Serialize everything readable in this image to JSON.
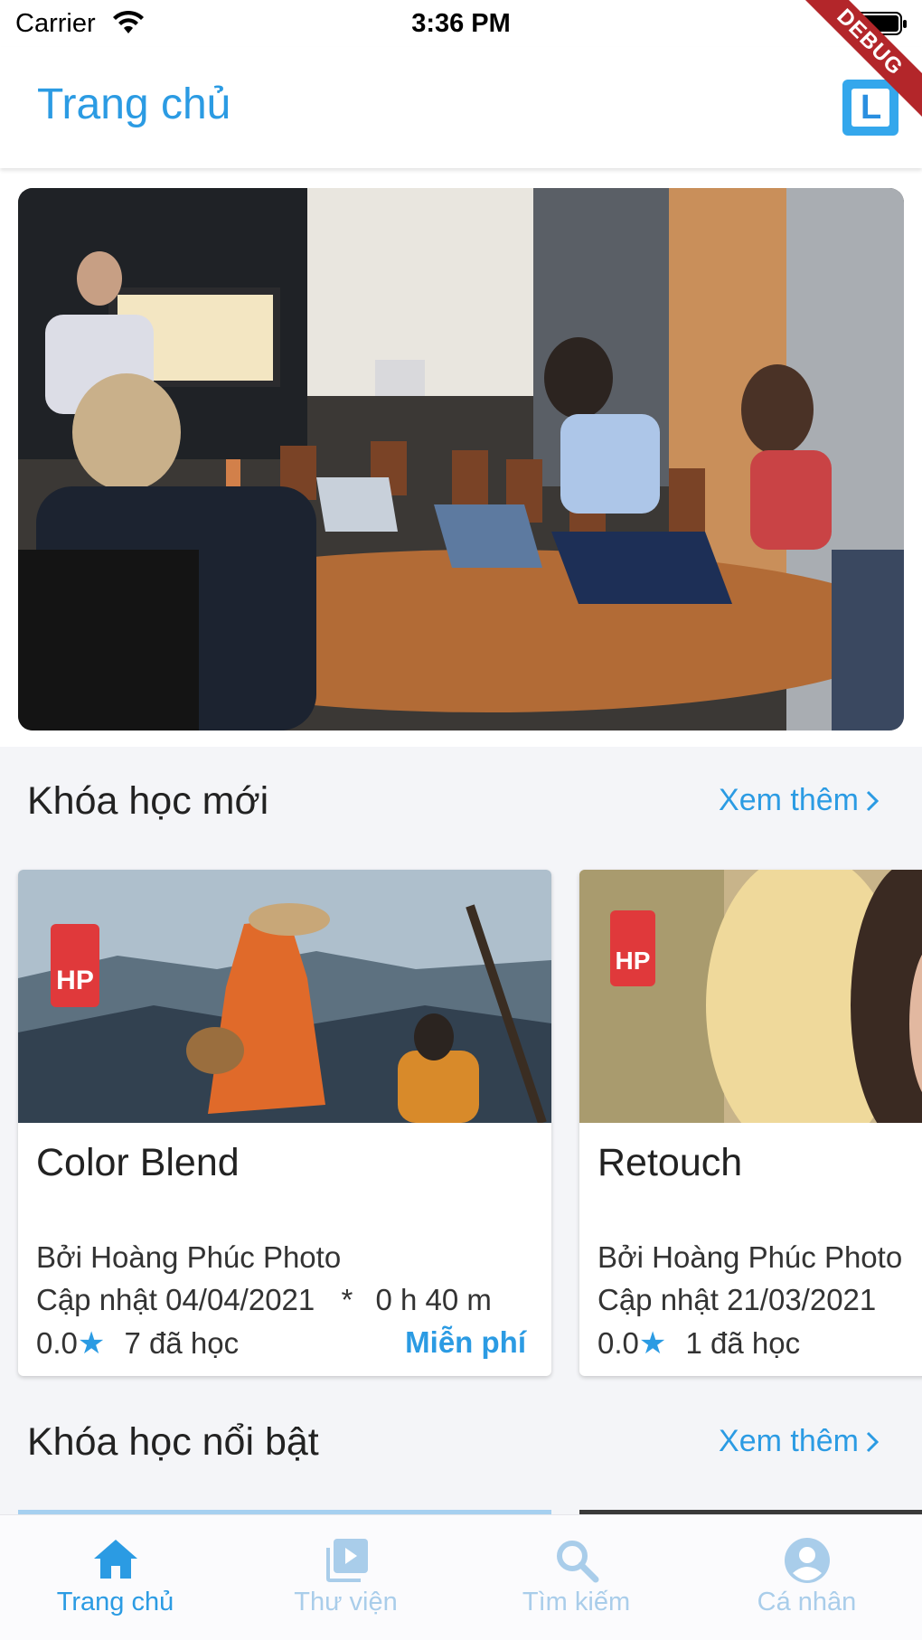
{
  "status_bar": {
    "carrier": "Carrier",
    "time": "3:36 PM"
  },
  "debug_label": "DEBUG",
  "app_bar": {
    "title": "Trang chủ",
    "logo_letter": "L"
  },
  "sections": {
    "new_courses": {
      "title": "Khóa học mới",
      "see_more": "Xem thêm"
    },
    "featured_courses": {
      "title": "Khóa học nổi bật",
      "see_more": "Xem thêm"
    }
  },
  "courses": [
    {
      "badge": "HP",
      "title": "Color Blend",
      "author": "Bởi Hoàng Phúc Photo",
      "updated": "Cập nhật 04/04/2021",
      "separator": "*",
      "duration": "0 h 40 m",
      "rating": "0.0",
      "learners": "7 đã học",
      "price": "Miễn phí"
    },
    {
      "badge": "HP",
      "title": "Retouch",
      "author": "Bởi Hoàng Phúc Photo",
      "updated": "Cập nhật 21/03/2021",
      "rating": "0.0",
      "learners": "1 đã học"
    }
  ],
  "bottom_nav": [
    {
      "label": "Trang chủ",
      "icon": "home-icon",
      "active": true
    },
    {
      "label": "Thư viện",
      "icon": "video-library-icon",
      "active": false
    },
    {
      "label": "Tìm kiếm",
      "icon": "search-icon",
      "active": false
    },
    {
      "label": "Cá nhân",
      "icon": "account-icon",
      "active": false
    }
  ],
  "colors": {
    "accent": "#2b9be3",
    "badge": "#e0393b",
    "debug": "#b3262a"
  }
}
